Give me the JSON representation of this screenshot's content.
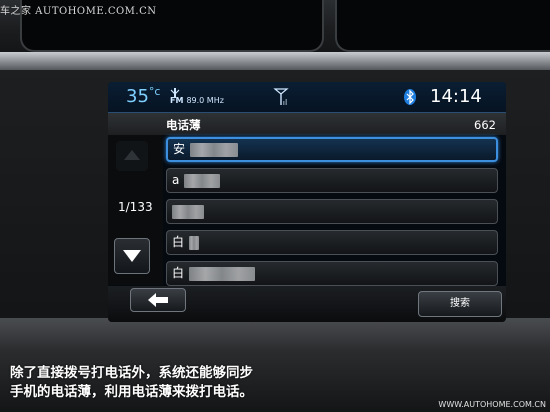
{
  "watermark": {
    "top_left": "车之家 AUTOHOME.COM.CN",
    "bottom_right": "WWW.AUTOHOME.COM.CN"
  },
  "caption": {
    "line1": "除了直接拨号打电话外，系统还能够同步",
    "line2": "手机的电话薄，利用电话薄来拨打电话。"
  },
  "status_bar": {
    "temperature": "35",
    "temperature_unit": "°c",
    "radio_band": "FM",
    "radio_frequency": "89.0 MHz",
    "clock": "14:14",
    "icons": [
      "radio-antenna-icon",
      "signal-icon",
      "bluetooth-icon"
    ]
  },
  "phonebook": {
    "title": "电话薄",
    "count": "662",
    "page_indicator": "1/133",
    "selected_index": 0,
    "entries": [
      {
        "label": "安"
      },
      {
        "label": "a"
      },
      {
        "label": ""
      },
      {
        "label": "白"
      },
      {
        "label": "白"
      }
    ]
  },
  "controls": {
    "search_label": "搜索",
    "back_icon": "back-arrow-icon",
    "scroll_up_icon": "triangle-up-icon",
    "scroll_down_icon": "triangle-down-icon"
  },
  "colors": {
    "accent_blue": "#3d8fe0",
    "temperature_cyan": "#7fd0ff"
  }
}
